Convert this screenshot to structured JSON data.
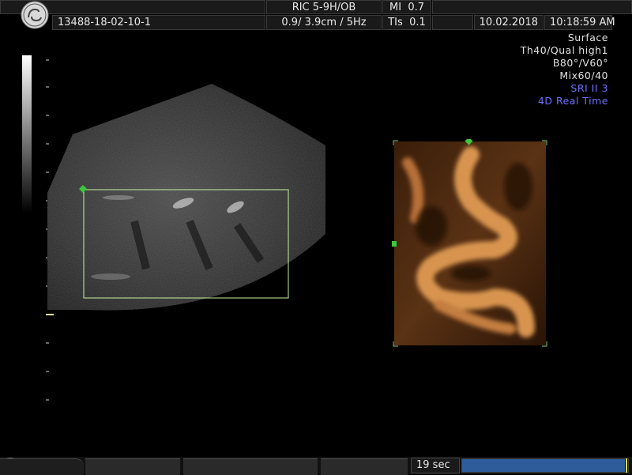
{
  "header": {
    "patient_id": "13488-18-02-10-1",
    "probe": "RIC 5-9H/OB",
    "mi_label": "MI",
    "mi_value": "0.7",
    "depth_freq": "0.9/ 3.9cm /  5Hz",
    "tis_label": "TIs",
    "tis_value": "0.1",
    "date": "10.02.2018",
    "time": "10:18:59 AM"
  },
  "info_panel": {
    "lines": [
      "Surface",
      "Th40/Qual high1",
      "B80°/V60°",
      "Mix60/40"
    ],
    "blue_lines": [
      "SRI II 3",
      "4D Real Time"
    ]
  },
  "footer": {
    "timer": "19 sec",
    "progress": 0.98
  },
  "colors": {
    "accent_blue": "#7070ff",
    "roi_green": "#c8f0a0",
    "render_orange": "#c8843c",
    "progress_blue": "#2e5c9a"
  },
  "icons": {
    "logo": "ge-logo",
    "bottom_left": "trackball-icon"
  }
}
